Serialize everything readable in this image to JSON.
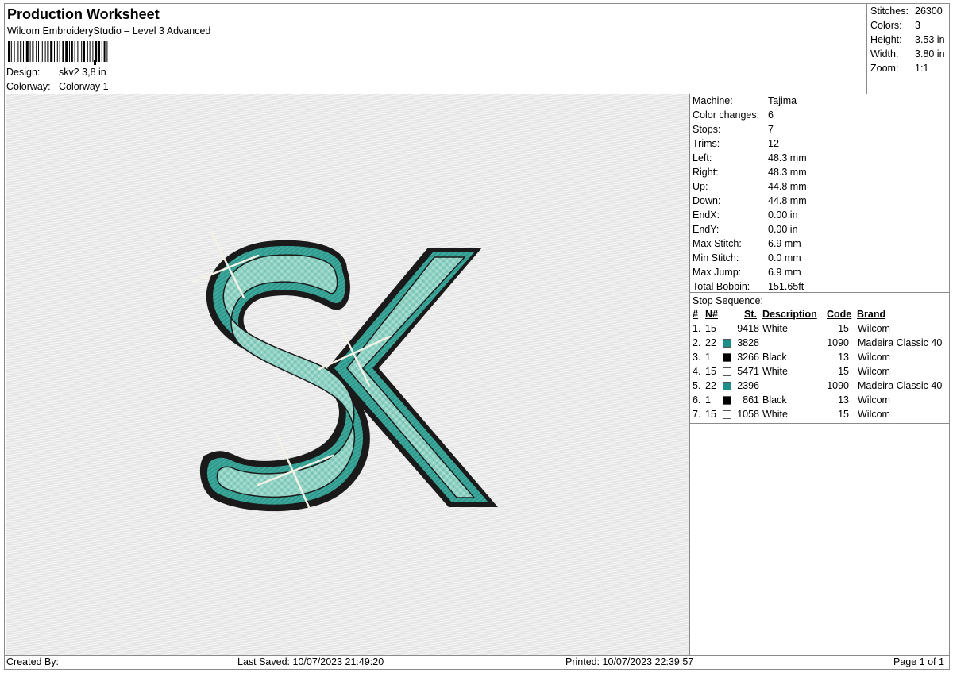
{
  "header": {
    "title": "Production Worksheet",
    "subtitle": "Wilcom EmbroideryStudio – Level 3 Advanced",
    "design_label": "Design:",
    "design_value": "skv2 3,8 in",
    "colorway_label": "Colorway:",
    "colorway_value": "Colorway 1"
  },
  "summary": {
    "stitches_label": "Stitches:",
    "stitches_value": "26300",
    "colors_label": "Colors:",
    "colors_value": "3",
    "height_label": "Height:",
    "height_value": "3.53 in",
    "width_label": "Width:",
    "width_value": "3.80 in",
    "zoom_label": "Zoom:",
    "zoom_value": "1:1"
  },
  "machine_info": [
    {
      "label": "Machine:",
      "value": "Tajima"
    },
    {
      "label": "Color changes:",
      "value": "6"
    },
    {
      "label": "Stops:",
      "value": "7"
    },
    {
      "label": "Trims:",
      "value": "12"
    },
    {
      "label": "Left:",
      "value": "48.3 mm"
    },
    {
      "label": "Right:",
      "value": "48.3 mm"
    },
    {
      "label": "Up:",
      "value": "44.8 mm"
    },
    {
      "label": "Down:",
      "value": "44.8 mm"
    },
    {
      "label": "EndX:",
      "value": "0.00 in"
    },
    {
      "label": "EndY:",
      "value": "0.00 in"
    },
    {
      "label": "Max Stitch:",
      "value": "6.9 mm"
    },
    {
      "label": "Min Stitch:",
      "value": "0.0 mm"
    },
    {
      "label": "Max Jump:",
      "value": "6.9 mm"
    },
    {
      "label": "Total Bobbin:",
      "value": "151.65ft"
    }
  ],
  "stop_sequence": {
    "title": "Stop Sequence:",
    "headers": {
      "index": "#",
      "needle": "N#",
      "stitches": "St.",
      "description": "Description",
      "code": "Code",
      "brand": "Brand"
    },
    "rows": [
      {
        "index": "1.",
        "needle": "15",
        "swatch": "#ffffff",
        "stitches": "9418",
        "description": "White",
        "code": "15",
        "brand": "Wilcom"
      },
      {
        "index": "2.",
        "needle": "22",
        "swatch": "#1c8f88",
        "stitches": "3828",
        "description": "",
        "code": "1090",
        "brand": "Madeira Classic 40"
      },
      {
        "index": "3.",
        "needle": "1",
        "swatch": "#000000",
        "stitches": "3266",
        "description": "Black",
        "code": "13",
        "brand": "Wilcom"
      },
      {
        "index": "4.",
        "needle": "15",
        "swatch": "#ffffff",
        "stitches": "5471",
        "description": "White",
        "code": "15",
        "brand": "Wilcom"
      },
      {
        "index": "5.",
        "needle": "22",
        "swatch": "#1c8f88",
        "stitches": "2396",
        "description": "",
        "code": "1090",
        "brand": "Madeira Classic 40"
      },
      {
        "index": "6.",
        "needle": "1",
        "swatch": "#000000",
        "stitches": "861",
        "description": "Black",
        "code": "13",
        "brand": "Wilcom"
      },
      {
        "index": "7.",
        "needle": "15",
        "swatch": "#ffffff",
        "stitches": "1058",
        "description": "White",
        "code": "15",
        "brand": "Wilcom"
      }
    ]
  },
  "footer": {
    "created_by": "Created By:",
    "last_saved": "Last Saved: 10/07/2023 21:49:20",
    "printed": "Printed: 10/07/2023 22:39:57",
    "page": "Page 1 of 1"
  },
  "colors": {
    "teal": "#1c8f88",
    "teal_light": "#7cc9bb",
    "outline": "#1a1a1a",
    "border": "#8a8a8a"
  }
}
